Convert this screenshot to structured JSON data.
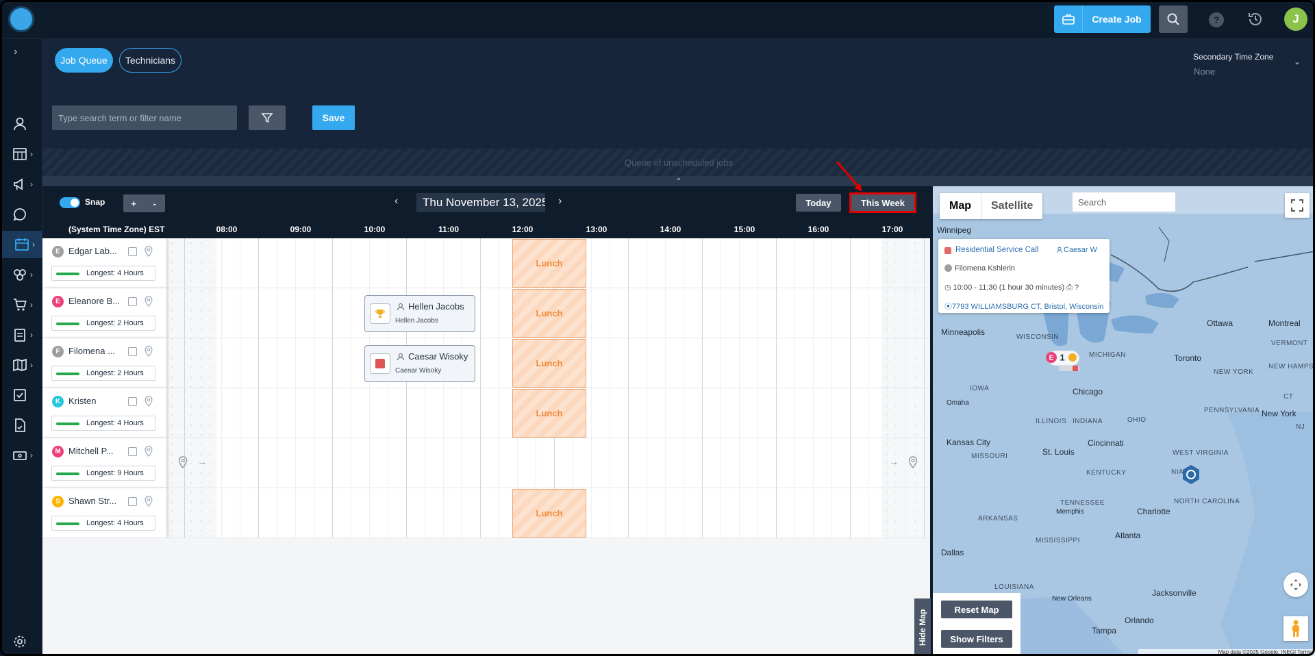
{
  "topbar": {
    "create_job_label": "Create Job",
    "help_icon": "?",
    "avatar_initial": "J"
  },
  "sidebar": {
    "items": [
      {
        "icon": "user-icon"
      },
      {
        "icon": "calendar-grid-icon"
      },
      {
        "icon": "megaphone-icon"
      },
      {
        "icon": "chat-icon"
      },
      {
        "icon": "calendar-icon"
      },
      {
        "icon": "circles-icon"
      },
      {
        "icon": "cart-icon"
      },
      {
        "icon": "clipboard-icon"
      },
      {
        "icon": "map-book-icon"
      },
      {
        "icon": "checkbox-icon"
      },
      {
        "icon": "document-icon"
      },
      {
        "icon": "ticket-icon"
      },
      {
        "icon": "gear-icon"
      }
    ]
  },
  "dispatch": {
    "tabs": [
      "Job Queue",
      "Technicians"
    ],
    "secondary_tz_label": "Secondary Time Zone",
    "secondary_tz_value": "None",
    "search_placeholder": "Type search term or filter name",
    "save_label": "Save",
    "queue_text": "Queue of unscheduled jobs"
  },
  "schedule": {
    "snap_label": "Snap",
    "zoom_in": "+",
    "zoom_out": "-",
    "date": "Thu November 13, 2025",
    "today_label": "Today",
    "this_week_label": "This Week",
    "tz_column_label": "(System Time Zone) EST",
    "hours": [
      "08:00",
      "09:00",
      "10:00",
      "11:00",
      "12:00",
      "13:00",
      "14:00",
      "15:00",
      "16:00",
      "17:00"
    ],
    "technicians": [
      {
        "initial": "E",
        "name": "Edgar Lab...",
        "longest": "Longest: 4 Hours",
        "color": "#9e9e9e"
      },
      {
        "initial": "E",
        "name": "Eleanore B...",
        "longest": "Longest: 2 Hours",
        "color": "#ec407a"
      },
      {
        "initial": "F",
        "name": "Filomena ...",
        "longest": "Longest: 2 Hours",
        "color": "#9e9e9e"
      },
      {
        "initial": "K",
        "name": "Kristen",
        "longest": "Longest: 4 Hours",
        "color": "#26c6da"
      },
      {
        "initial": "M",
        "name": "Mitchell P...",
        "longest": "Longest: 9 Hours",
        "color": "#ec407a"
      },
      {
        "initial": "S",
        "name": "Shawn Str...",
        "longest": "Longest: 4 Hours",
        "color": "#ffb300"
      }
    ],
    "lunch_label": "Lunch",
    "jobs": [
      {
        "title": "Hellen Jacobs",
        "sub": "Hellen Jacobs",
        "icon": "trophy-icon"
      },
      {
        "title": "Caesar Wisoky",
        "sub": "Caesar Wisoky",
        "icon": "red-square-icon"
      }
    ]
  },
  "map": {
    "type_map": "Map",
    "type_satellite": "Satellite",
    "search_placeholder": "Search",
    "popup": {
      "title": "Residential Service Call",
      "assignee": "Caesar W",
      "tech": "Filomena Kshlerin",
      "time": "10:00 - 11:30 (1 hour 30 minutes)",
      "unknown": "?",
      "address": "7793 WILLIAMSBURG CT, Bristol, Wisconsin"
    },
    "cities": [
      "Winnipeg",
      "Minneapolis",
      "Ottawa",
      "Montreal",
      "Toronto",
      "Chicago",
      "Omaha",
      "Kansas City",
      "St. Louis",
      "Cincinnati",
      "Memphis",
      "Charlotte",
      "Atlanta",
      "Dallas",
      "New Orleans",
      "Jacksonville",
      "Tampa",
      "Orlando",
      "New York"
    ],
    "states": [
      "WISCONSIN",
      "MICHIGAN",
      "IOWA",
      "ILLINOIS",
      "INDIANA",
      "OHIO",
      "PENNSYLVANIA",
      "MISSOURI",
      "KENTUCKY",
      "WEST VIRGINIA",
      "TENNESSEE",
      "NORTH CAROLINA",
      "ARKANSAS",
      "MISSISSIPPI",
      "LOUISIANA",
      "VERMONT",
      "NEW HAMPSHIRE",
      "NEW YORK",
      "CT",
      "NJ",
      "NIA"
    ],
    "cluster_count": "1",
    "cluster_initial": "E",
    "reset_label": "Reset Map",
    "filters_label": "Show Filters",
    "hide_label": "Hide Map",
    "attribution": "Map data ©2025 Google, INEGI  Terms"
  }
}
